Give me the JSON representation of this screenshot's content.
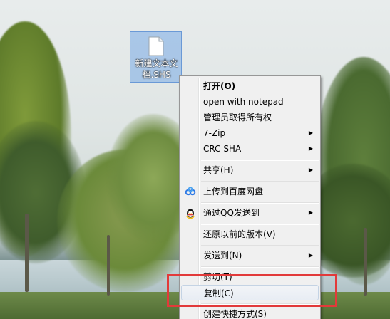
{
  "desktop": {
    "file_icon": {
      "label": "新建文本文档.SHS",
      "icon": "text-document-icon"
    }
  },
  "context_menu": {
    "items": [
      {
        "label": "打开(O)",
        "bold": true,
        "submenu": false,
        "icon": ""
      },
      {
        "label": "open with notepad",
        "bold": false,
        "submenu": false,
        "icon": ""
      },
      {
        "label": "管理员取得所有权",
        "bold": false,
        "submenu": false,
        "icon": ""
      },
      {
        "label": "7-Zip",
        "bold": false,
        "submenu": true,
        "icon": ""
      },
      {
        "label": "CRC SHA",
        "bold": false,
        "submenu": true,
        "icon": ""
      },
      {
        "label": "共享(H)",
        "bold": false,
        "submenu": true,
        "icon": ""
      },
      {
        "label": "上传到百度网盘",
        "bold": false,
        "submenu": false,
        "icon": "baidu-netdisk-icon"
      },
      {
        "label": "通过QQ发送到",
        "bold": false,
        "submenu": true,
        "icon": "qq-penguin-icon"
      },
      {
        "label": "还原以前的版本(V)",
        "bold": false,
        "submenu": false,
        "icon": ""
      },
      {
        "label": "发送到(N)",
        "bold": false,
        "submenu": true,
        "icon": ""
      },
      {
        "label": "剪切(T)",
        "bold": false,
        "submenu": false,
        "icon": ""
      },
      {
        "label": "复制(C)",
        "bold": false,
        "submenu": false,
        "icon": "",
        "hovered": true
      },
      {
        "label": "创建快捷方式(S)",
        "bold": false,
        "submenu": false,
        "icon": ""
      }
    ],
    "submenu_arrow": "▶"
  },
  "annotation": {
    "color": "#e23a3a"
  }
}
